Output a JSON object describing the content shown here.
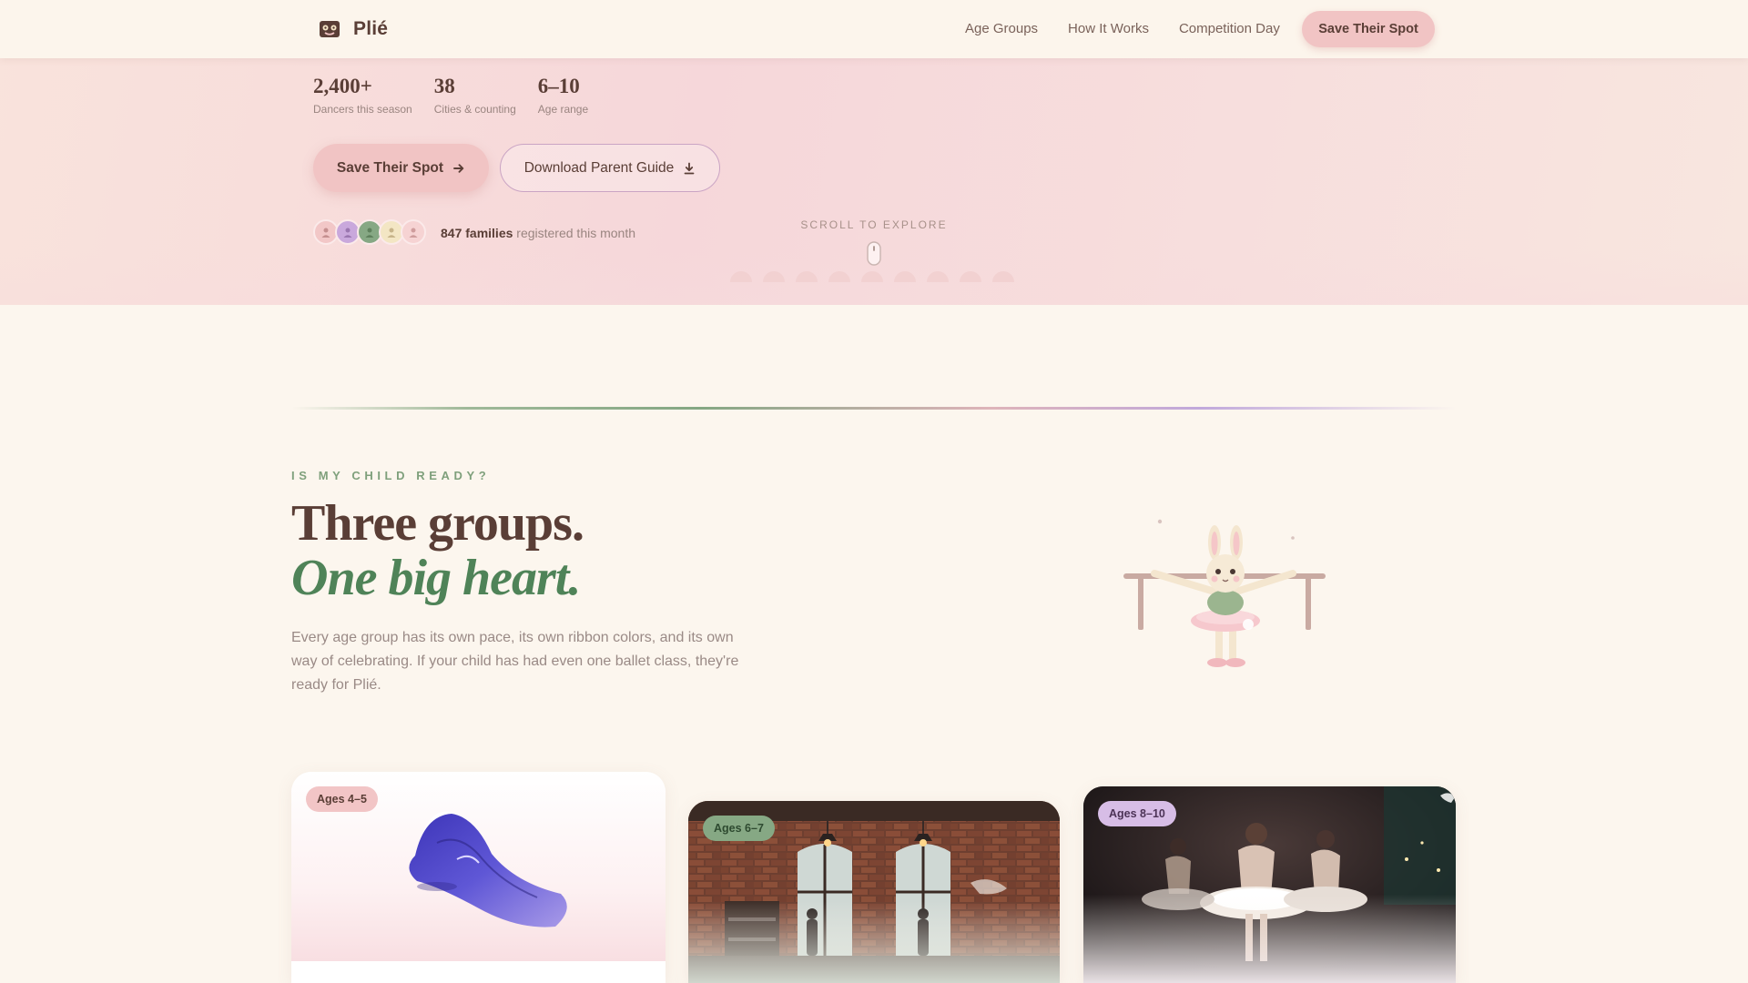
{
  "nav": {
    "brand": "Plié",
    "links": [
      "Age Groups",
      "How It Works",
      "Competition Day"
    ],
    "cta": "Save Their Spot"
  },
  "hero": {
    "stats": [
      {
        "value": "2,400+",
        "label": "Dancers this season"
      },
      {
        "value": "38",
        "label": "Cities & counting"
      },
      {
        "value": "6–10",
        "label": "Age range"
      }
    ],
    "primary_cta": "Save Their Spot",
    "secondary_cta": "Download Parent Guide",
    "families_count": "847 families",
    "families_text": "registered this month",
    "scroll_label": "SCROLL TO EXPLORE"
  },
  "intro": {
    "eyebrow": "IS MY CHILD READY?",
    "headline_line1": "Three groups.",
    "headline_line2": "One big heart.",
    "body": "Every age group has its own pace, its own ribbon colors, and its own way of celebrating. If your child has had even one ballet class, they're ready for Plié."
  },
  "cards": [
    {
      "badge": "Ages 4–5"
    },
    {
      "badge": "Ages 6–7"
    },
    {
      "badge": "Ages 8–10"
    }
  ],
  "colors": {
    "accent_pink": "#f1c4c4",
    "text_brown": "#5a3e36",
    "accent_green": "#4f8358",
    "accent_lilac": "#b69bd8",
    "background_cream": "#fcf6ee"
  },
  "icons": {
    "brand": "ballet-mask-icon",
    "primary_cta": "arrow-right-icon",
    "secondary_cta": "download-icon",
    "scroll": "mouse-icon"
  }
}
